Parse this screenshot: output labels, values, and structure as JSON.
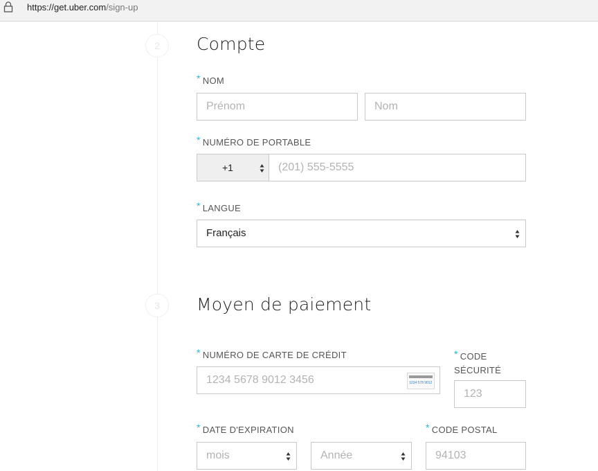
{
  "browser": {
    "url_prefix": "https://get.",
    "url_domain": "uber.com",
    "url_path": "/sign-up"
  },
  "steps": {
    "account_number": "2",
    "payment_number": "3"
  },
  "account": {
    "title": "Compte",
    "name_label": "NOM",
    "first_name_placeholder": "Prénom",
    "last_name_placeholder": "Nom",
    "phone_label": "NUMÉRO DE PORTABLE",
    "country_code": "+1",
    "phone_placeholder": "(201) 555-5555",
    "language_label": "LANGUE",
    "language_value": "Français"
  },
  "payment": {
    "title": "Moyen de paiement",
    "card_label": "NUMÉRO DE CARTE DE CRÉDIT",
    "card_placeholder": "1234 5678 9012 3456",
    "card_icon_text": "1234 578 9012",
    "cvv_label_line1": "CODE",
    "cvv_label_line2": "SÉCURITÉ",
    "cvv_placeholder": "123",
    "expiry_label": "DATE D'EXPIRATION",
    "month_placeholder": "mois",
    "year_placeholder": "Année",
    "postal_label": "CODE POSTAL",
    "postal_placeholder": "94103"
  },
  "colors": {
    "accent": "#1fbad6",
    "border": "#c9c9c9",
    "placeholder": "#b3b3b3"
  }
}
